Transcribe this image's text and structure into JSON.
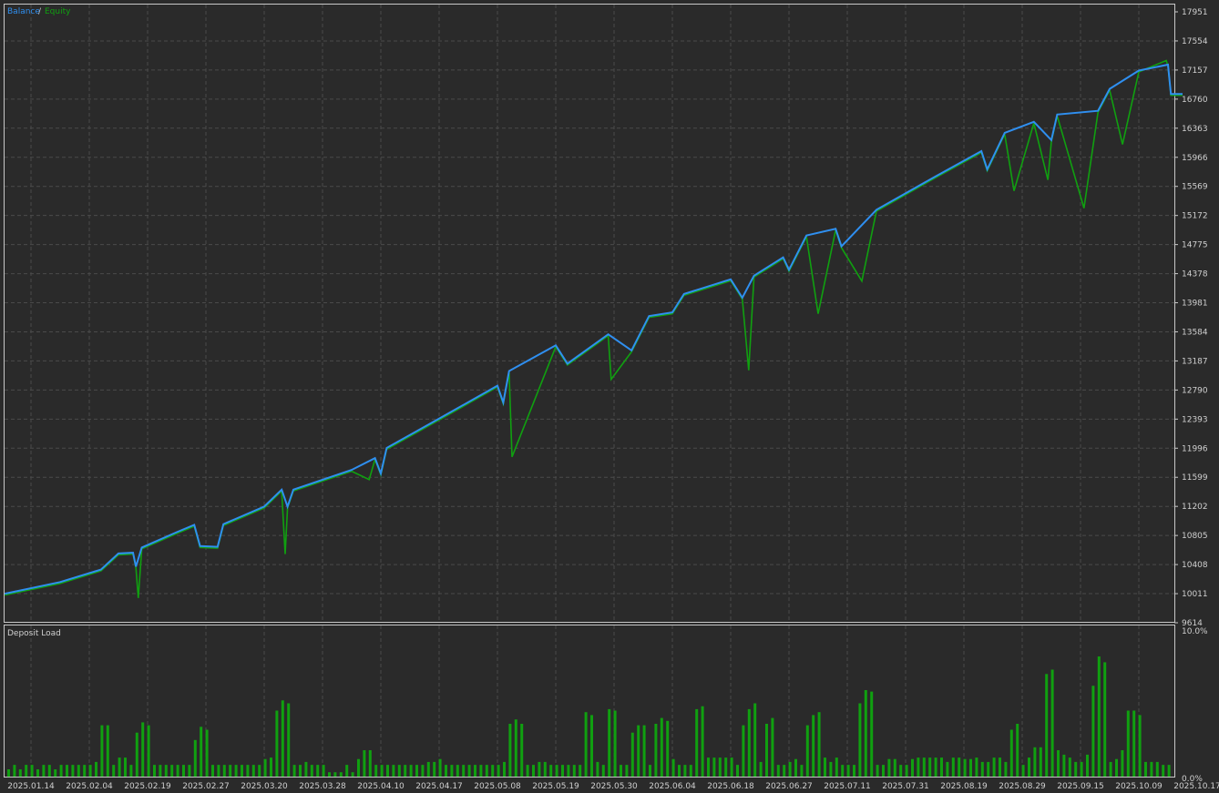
{
  "chart_data": [
    {
      "type": "line",
      "title": "",
      "legend": [
        {
          "name": "Balance",
          "color": "#2f8ff0"
        },
        {
          "name": "Equity",
          "color": "#10a010"
        }
      ],
      "legend_separator": "/",
      "legend_position": "top-left",
      "grid": true,
      "ylim": [
        9614,
        17951
      ],
      "y_ticks": [
        "17951",
        "17554",
        "17157",
        "16760",
        "16363",
        "15966",
        "15569",
        "15172",
        "14775",
        "14378",
        "13981",
        "13584",
        "13187",
        "12790",
        "12393",
        "11996",
        "11599",
        "11202",
        "10805",
        "10408",
        "10011",
        "9614"
      ],
      "x_ticks": [
        "2025.01.14",
        "2025.02.04",
        "2025.02.19",
        "2025.02.27",
        "2025.03.20",
        "2025.03.28",
        "2025.04.10",
        "2025.04.17",
        "2025.05.08",
        "2025.05.19",
        "2025.05.30",
        "2025.06.04",
        "2025.06.18",
        "2025.06.27",
        "2025.07.11",
        "2025.07.31",
        "2025.08.19",
        "2025.08.29",
        "2025.09.15",
        "2025.10.09",
        "2025.10.17"
      ],
      "x_unit": "tick index",
      "balance": [
        [
          -0.45,
          10010
        ],
        [
          0.5,
          10170
        ],
        [
          1.2,
          10340
        ],
        [
          1.5,
          10560
        ],
        [
          1.75,
          10570
        ],
        [
          1.8,
          10380
        ],
        [
          1.9,
          10640
        ],
        [
          2.5,
          10850
        ],
        [
          2.8,
          10950
        ],
        [
          2.9,
          10660
        ],
        [
          3.2,
          10650
        ],
        [
          3.3,
          10960
        ],
        [
          4.0,
          11200
        ],
        [
          4.3,
          11430
        ],
        [
          4.4,
          11200
        ],
        [
          4.5,
          11430
        ],
        [
          5.5,
          11700
        ],
        [
          5.9,
          11860
        ],
        [
          6.0,
          11650
        ],
        [
          6.1,
          12000
        ],
        [
          7.0,
          12400
        ],
        [
          8.0,
          12850
        ],
        [
          8.1,
          12620
        ],
        [
          8.2,
          13050
        ],
        [
          9.0,
          13400
        ],
        [
          9.2,
          13150
        ],
        [
          9.9,
          13550
        ],
        [
          10.3,
          13330
        ],
        [
          10.6,
          13800
        ],
        [
          11.0,
          13850
        ],
        [
          11.2,
          14100
        ],
        [
          12.0,
          14300
        ],
        [
          12.2,
          14050
        ],
        [
          12.4,
          14350
        ],
        [
          12.9,
          14600
        ],
        [
          13.0,
          14430
        ],
        [
          13.3,
          14900
        ],
        [
          13.8,
          14990
        ],
        [
          13.9,
          14750
        ],
        [
          14.5,
          15250
        ],
        [
          15.5,
          15700
        ],
        [
          16.3,
          16050
        ],
        [
          16.4,
          15800
        ],
        [
          16.7,
          16300
        ],
        [
          17.2,
          16450
        ],
        [
          17.5,
          16200
        ],
        [
          17.6,
          16550
        ],
        [
          18.3,
          16600
        ],
        [
          18.5,
          16900
        ],
        [
          19.0,
          17150
        ],
        [
          19.5,
          17230
        ],
        [
          19.55,
          16830
        ],
        [
          19.75,
          16830
        ]
      ],
      "equity_dips": [
        [
          1.84,
          9971
        ],
        [
          4.36,
          10570
        ],
        [
          5.8,
          11587
        ],
        [
          8.25,
          11897
        ],
        [
          9.95,
          12954
        ],
        [
          12.31,
          13078
        ],
        [
          13.5,
          13849
        ],
        [
          14.25,
          14296
        ],
        [
          16.86,
          15527
        ],
        [
          17.44,
          15676
        ],
        [
          18.06,
          15291
        ],
        [
          18.72,
          16161
        ],
        [
          19.47,
          17305
        ]
      ]
    },
    {
      "type": "bar",
      "title": "Deposit Load",
      "ylim": [
        0,
        10
      ],
      "y_ticks": [
        "10.0%",
        "0.0%"
      ],
      "unit": "%",
      "color": "#10a010",
      "values": [
        0.5,
        0.8,
        0.5,
        0.8,
        0.8,
        0.5,
        0.8,
        0.8,
        0.5,
        0.8,
        0.8,
        0.8,
        0.8,
        0.8,
        0.8,
        1.0,
        3.5,
        3.5,
        0.8,
        1.3,
        1.3,
        0.8,
        3.0,
        3.7,
        3.5,
        0.8,
        0.8,
        0.8,
        0.8,
        0.8,
        0.8,
        0.8,
        2.5,
        3.4,
        3.2,
        0.8,
        0.8,
        0.8,
        0.8,
        0.8,
        0.8,
        0.8,
        0.8,
        0.8,
        1.2,
        1.3,
        4.5,
        5.2,
        5.0,
        0.8,
        0.8,
        1.0,
        0.8,
        0.8,
        0.8,
        0.3,
        0.3,
        0.3,
        0.8,
        0.3,
        1.2,
        1.8,
        1.8,
        0.8,
        0.8,
        0.8,
        0.8,
        0.8,
        0.8,
        0.8,
        0.8,
        0.8,
        1.0,
        1.0,
        1.2,
        0.8,
        0.8,
        0.8,
        0.8,
        0.8,
        0.8,
        0.8,
        0.8,
        0.8,
        0.8,
        1.0,
        3.6,
        3.9,
        3.6,
        0.8,
        0.8,
        1.0,
        1.0,
        0.8,
        0.8,
        0.8,
        0.8,
        0.8,
        0.8,
        4.4,
        4.2,
        1.0,
        0.8,
        4.6,
        4.5,
        0.8,
        0.8,
        3.0,
        3.5,
        3.5,
        0.8,
        3.6,
        4.0,
        3.8,
        1.2,
        0.8,
        0.8,
        0.8,
        4.6,
        4.8,
        1.3,
        1.3,
        1.3,
        1.3,
        1.3,
        0.8,
        3.5,
        4.6,
        5.0,
        1.0,
        3.6,
        4.0,
        0.8,
        0.8,
        1.0,
        1.2,
        0.8,
        3.5,
        4.2,
        4.4,
        1.3,
        1.0,
        1.3,
        0.8,
        0.8,
        0.8,
        5.0,
        5.9,
        5.8,
        0.8,
        0.8,
        1.2,
        1.2,
        0.8,
        0.8,
        1.2,
        1.3,
        1.3,
        1.3,
        1.3,
        1.3,
        1.0,
        1.3,
        1.3,
        1.2,
        1.2,
        1.3,
        1.0,
        1.0,
        1.3,
        1.3,
        1.0,
        3.2,
        3.6,
        0.8,
        1.3,
        2.0,
        2.0,
        7.0,
        7.3,
        1.8,
        1.5,
        1.3,
        1.0,
        1.0,
        1.5,
        6.2,
        8.2,
        7.8,
        1.0,
        1.2,
        1.8,
        4.5,
        4.5,
        4.2,
        1.0,
        1.0,
        1.0,
        0.8,
        0.8
      ]
    }
  ]
}
